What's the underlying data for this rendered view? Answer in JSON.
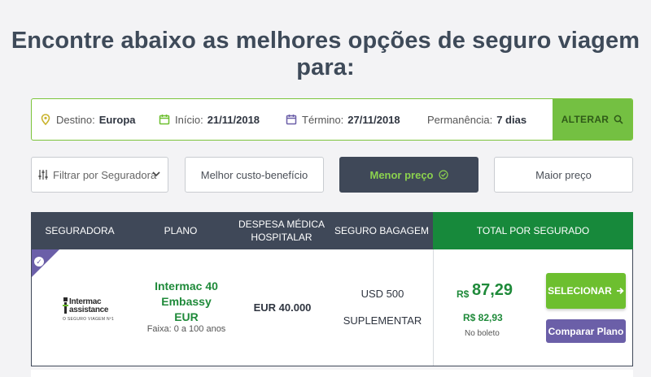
{
  "headline": "Encontre abaixo as melhores opções de seguro viagem para:",
  "search": {
    "destino_label": "Destino:",
    "destino_value": "Europa",
    "inicio_label": "Início:",
    "inicio_value": "21/11/2018",
    "termino_label": "Término:",
    "termino_value": "27/11/2018",
    "permanencia_label": "Permanência:",
    "permanencia_value": "7 dias",
    "alterar_label": "ALTERAR",
    "icons": [
      "map-pin-icon",
      "calendar-icon",
      "calendar-icon",
      "search-icon"
    ]
  },
  "filters": {
    "seguradora_placeholder": "Filtrar por Seguradora",
    "custo": "Melhor custo-benefício",
    "menor": "Menor preço",
    "maior": "Maior preço"
  },
  "table": {
    "headers": {
      "seguradora": "SEGURADORA",
      "plano": "PLANO",
      "despesa_l1": "DESPESA MÉDICA",
      "despesa_l2": "HOSPITALAR",
      "bagagem": "SEGURO BAGAGEM",
      "total": "TOTAL POR SEGURADO"
    },
    "rows": [
      {
        "logo_l1": "Intermac",
        "logo_l2": "assistance",
        "logo_l3": "O SEGURO VIAGEM Nº1",
        "plan_l1": "Intermac 40 Embassy",
        "plan_l2": "EUR",
        "faixa": "Faixa: 0 a 100 anos",
        "despesa": "EUR 40.000",
        "bagagem_l1": "USD 500",
        "bagagem_l2": "SUPLEMENTAR",
        "currency": "R$",
        "price": "87,29",
        "price_boleto": "R$ 82,93",
        "price_note": "No boleto",
        "select_label": "SELECIONAR",
        "compare_label": "Comparar Plano"
      }
    ]
  },
  "colors": {
    "dark": "#3f4858",
    "green": "#74c042",
    "dark_green": "#17893b",
    "purple": "#6b5fa8"
  }
}
